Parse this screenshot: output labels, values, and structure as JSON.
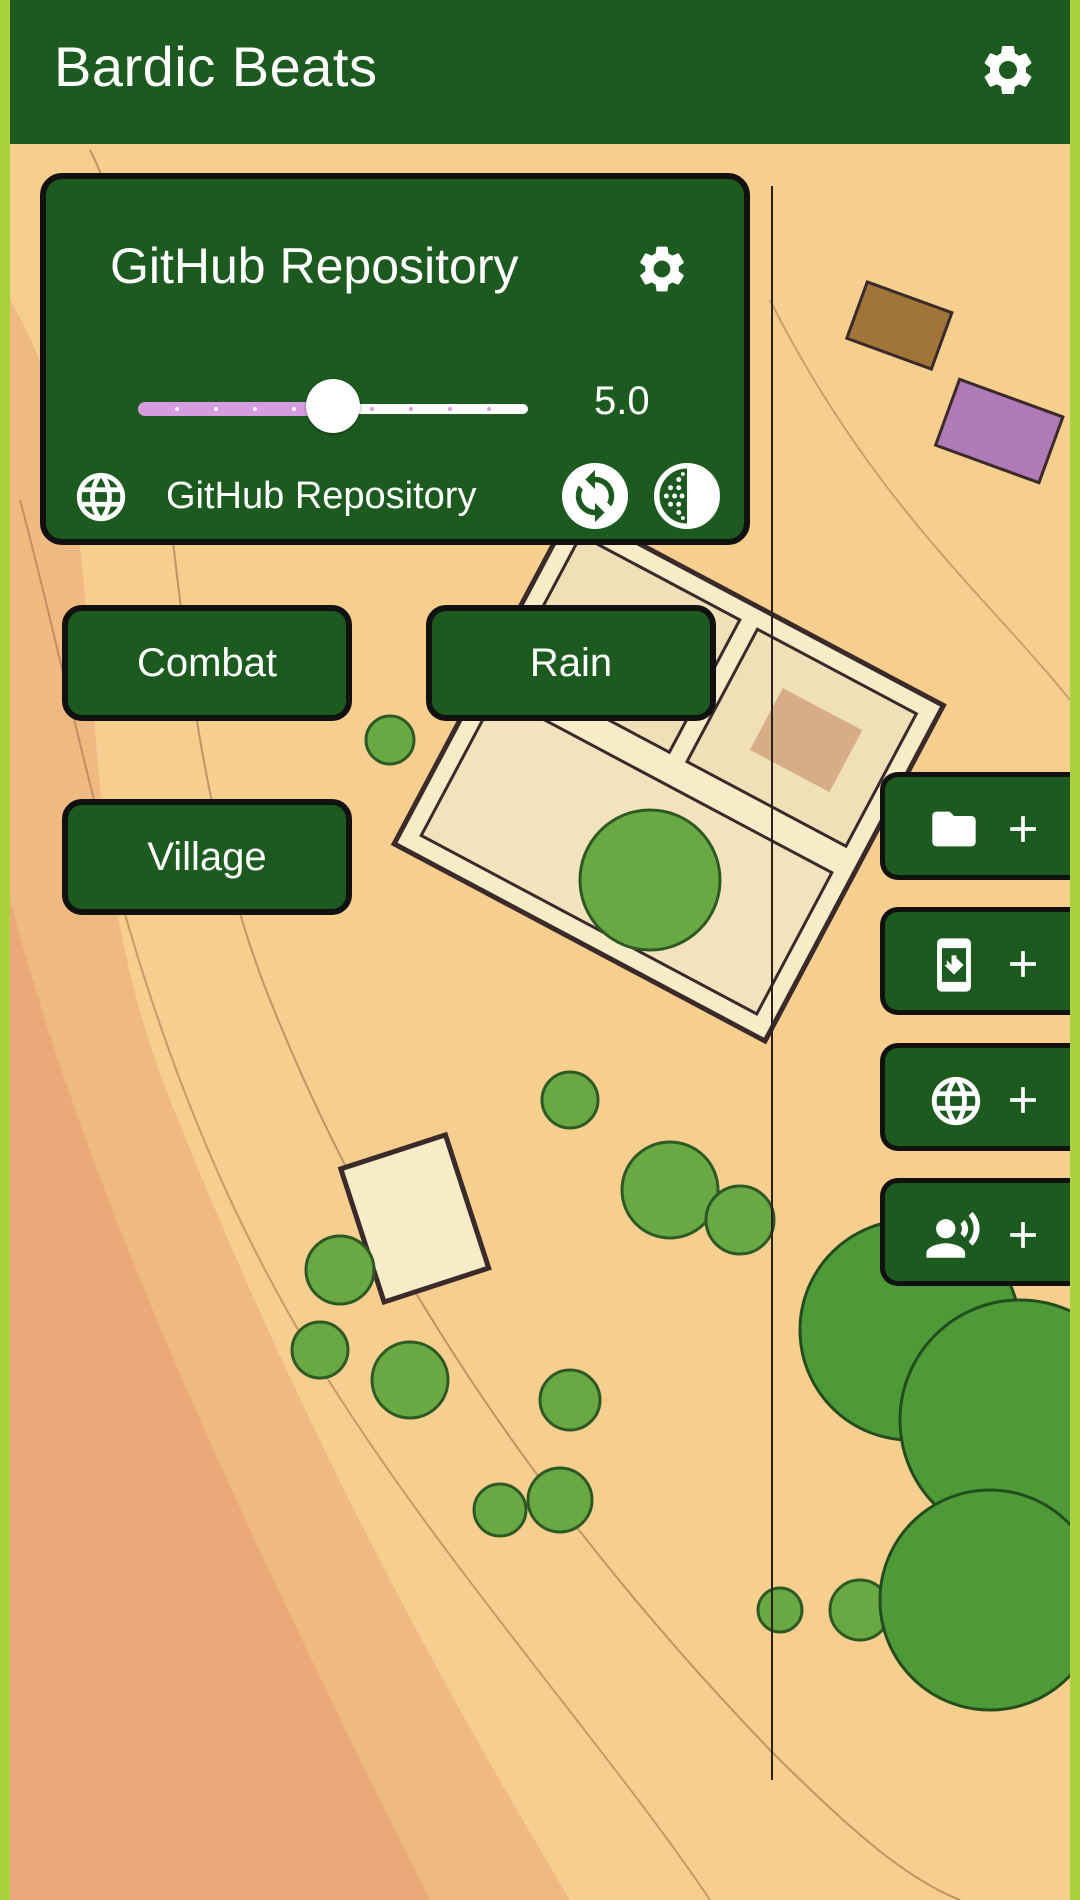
{
  "app": {
    "title": "Bardic Beats",
    "settings_icon": "gear-icon"
  },
  "card": {
    "title": "GitHub Repository",
    "settings_icon": "gear-icon",
    "volume": {
      "value_label": "5.0",
      "value": 5.0,
      "min": 0,
      "max": 10,
      "steps": 10
    },
    "source_icon": "globe-icon",
    "source_label": "GitHub Repository",
    "sync_icon": "sync-icon",
    "contrast_icon": "contrast-icon"
  },
  "scenes": [
    {
      "label": "Combat"
    },
    {
      "label": "Rain"
    },
    {
      "label": "Village"
    }
  ],
  "side_actions": [
    {
      "icon": "folder-icon",
      "badge": "plus-icon"
    },
    {
      "icon": "phone-download-icon",
      "badge": "plus-icon"
    },
    {
      "icon": "globe-icon",
      "badge": "plus-icon"
    },
    {
      "icon": "voice-icon",
      "badge": "plus-icon"
    }
  ],
  "colors": {
    "primary": "#1c5a20",
    "accent": "#d79be0",
    "background": "#f6cf8e"
  }
}
